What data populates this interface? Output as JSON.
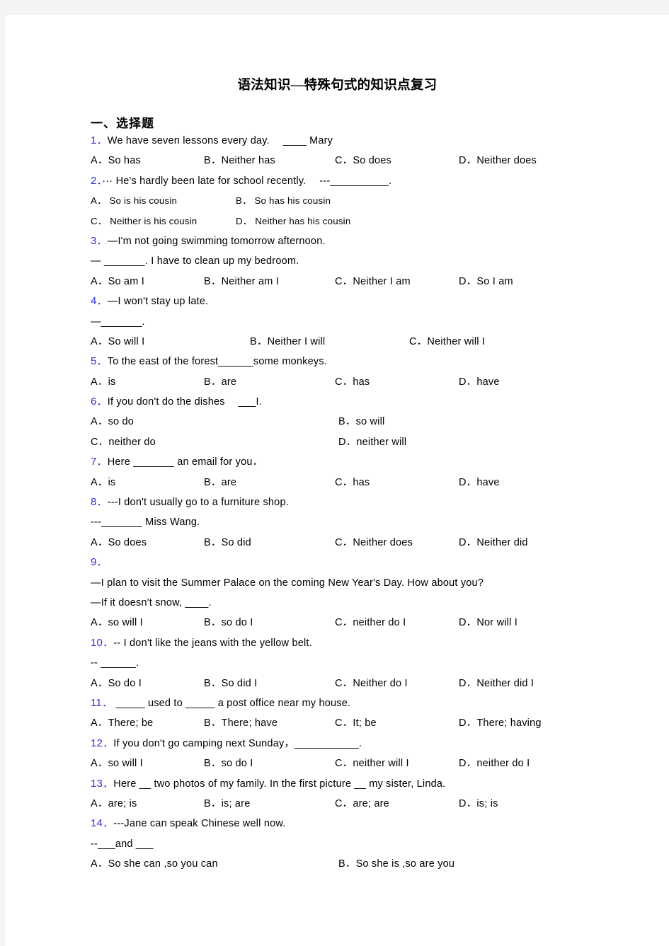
{
  "document": {
    "title": "语法知识—特殊句式的知识点复习",
    "section_heading": "一、选择题"
  },
  "questions": [
    {
      "number": "1．",
      "stem_lines": [
        "We have seven lessons every day.　 ____ Mary"
      ],
      "options": [
        "A．So has",
        "B．Neither has",
        "C．So does",
        "D．Neither does"
      ],
      "layout": "c4"
    },
    {
      "number": "2．",
      "stem_lines": [
        "··· He's hardly been late for school recently.　 ---__________."
      ],
      "options": [
        "A．  So is his cousin",
        "B．  So has his cousin",
        "C．  Neither is his cousin",
        "D．  Neither has his cousin"
      ],
      "layout": "c2b"
    },
    {
      "number": "3．",
      "stem_lines": [
        "—I'm not going swimming tomorrow afternoon.",
        "— _______. I have to clean up my bedroom."
      ],
      "options": [
        "A．So am I",
        "B．Neither am I",
        "C．Neither I am",
        "D．So I am"
      ],
      "layout": "c4"
    },
    {
      "number": "4．",
      "stem_lines": [
        "—I won't stay up late.",
        "—_______."
      ],
      "options": [
        "A．So will I",
        "B．Neither I will",
        "C．Neither will I"
      ],
      "layout": "c3"
    },
    {
      "number": "5．",
      "stem_lines": [
        "To the east of the forest______some monkeys."
      ],
      "options": [
        "A．is",
        "B．are",
        "C．has",
        "D．have"
      ],
      "layout": "c4"
    },
    {
      "number": "6．",
      "stem_lines": [
        "If you don't do the dishes 　___I."
      ],
      "options": [
        "A．so do",
        "B．so will",
        "C．neither do",
        "D．neither will"
      ],
      "layout": "c2"
    },
    {
      "number": "7．",
      "stem_lines": [
        "Here _______ an email for you．"
      ],
      "options": [
        "A．is",
        "B．are",
        "C．has",
        "D．have"
      ],
      "layout": "c4"
    },
    {
      "number": "8．",
      "stem_lines": [
        "---I don't usually go to a furniture shop.",
        "---_______ Miss Wang."
      ],
      "options": [
        "A．So does",
        "B．So did",
        "C．Neither does",
        "D．Neither did"
      ],
      "layout": "c4"
    },
    {
      "number": "9．",
      "stem_lines": [
        "",
        "—I plan to visit the Summer Palace on the coming New Year's Day. How about you?",
        "—If it doesn't snow, ____."
      ],
      "options": [
        "A．so will I",
        "B．so do I",
        "C．neither do I",
        "D．Nor will I"
      ],
      "layout": "c4"
    },
    {
      "number": "10．",
      "stem_lines": [
        "-- I don't like the jeans with the yellow belt.",
        "-- ______."
      ],
      "options": [
        "A．So do I",
        "B．So did I",
        "C．Neither do I",
        "D．Neither did I"
      ],
      "layout": "c4"
    },
    {
      "number": "11．",
      "stem_lines": [
        " _____ used to _____ a post office near my house."
      ],
      "options": [
        "A．There; be",
        "B．There; have",
        "C．It; be",
        "D．There; having"
      ],
      "layout": "c4"
    },
    {
      "number": "12．",
      "stem_lines": [
        "If you don't go camping next Sunday，___________."
      ],
      "options": [
        "A．so will I",
        "B．so do I",
        "C．neither will I",
        "D．neither do I"
      ],
      "layout": "c4"
    },
    {
      "number": "13．",
      "stem_lines": [
        "Here __  two photos of my family. In the first picture __ my sister, Linda."
      ],
      "options": [
        "A．are; is",
        "B．is; are",
        "C．are; are",
        "D．is; is"
      ],
      "layout": "c4"
    },
    {
      "number": "14．",
      "stem_lines": [
        "---Jane can speak Chinese well now.",
        "--___and ___"
      ],
      "options": [
        "A．So she can ,so you can",
        "B．So she is ,so are you"
      ],
      "layout": "c2"
    }
  ]
}
